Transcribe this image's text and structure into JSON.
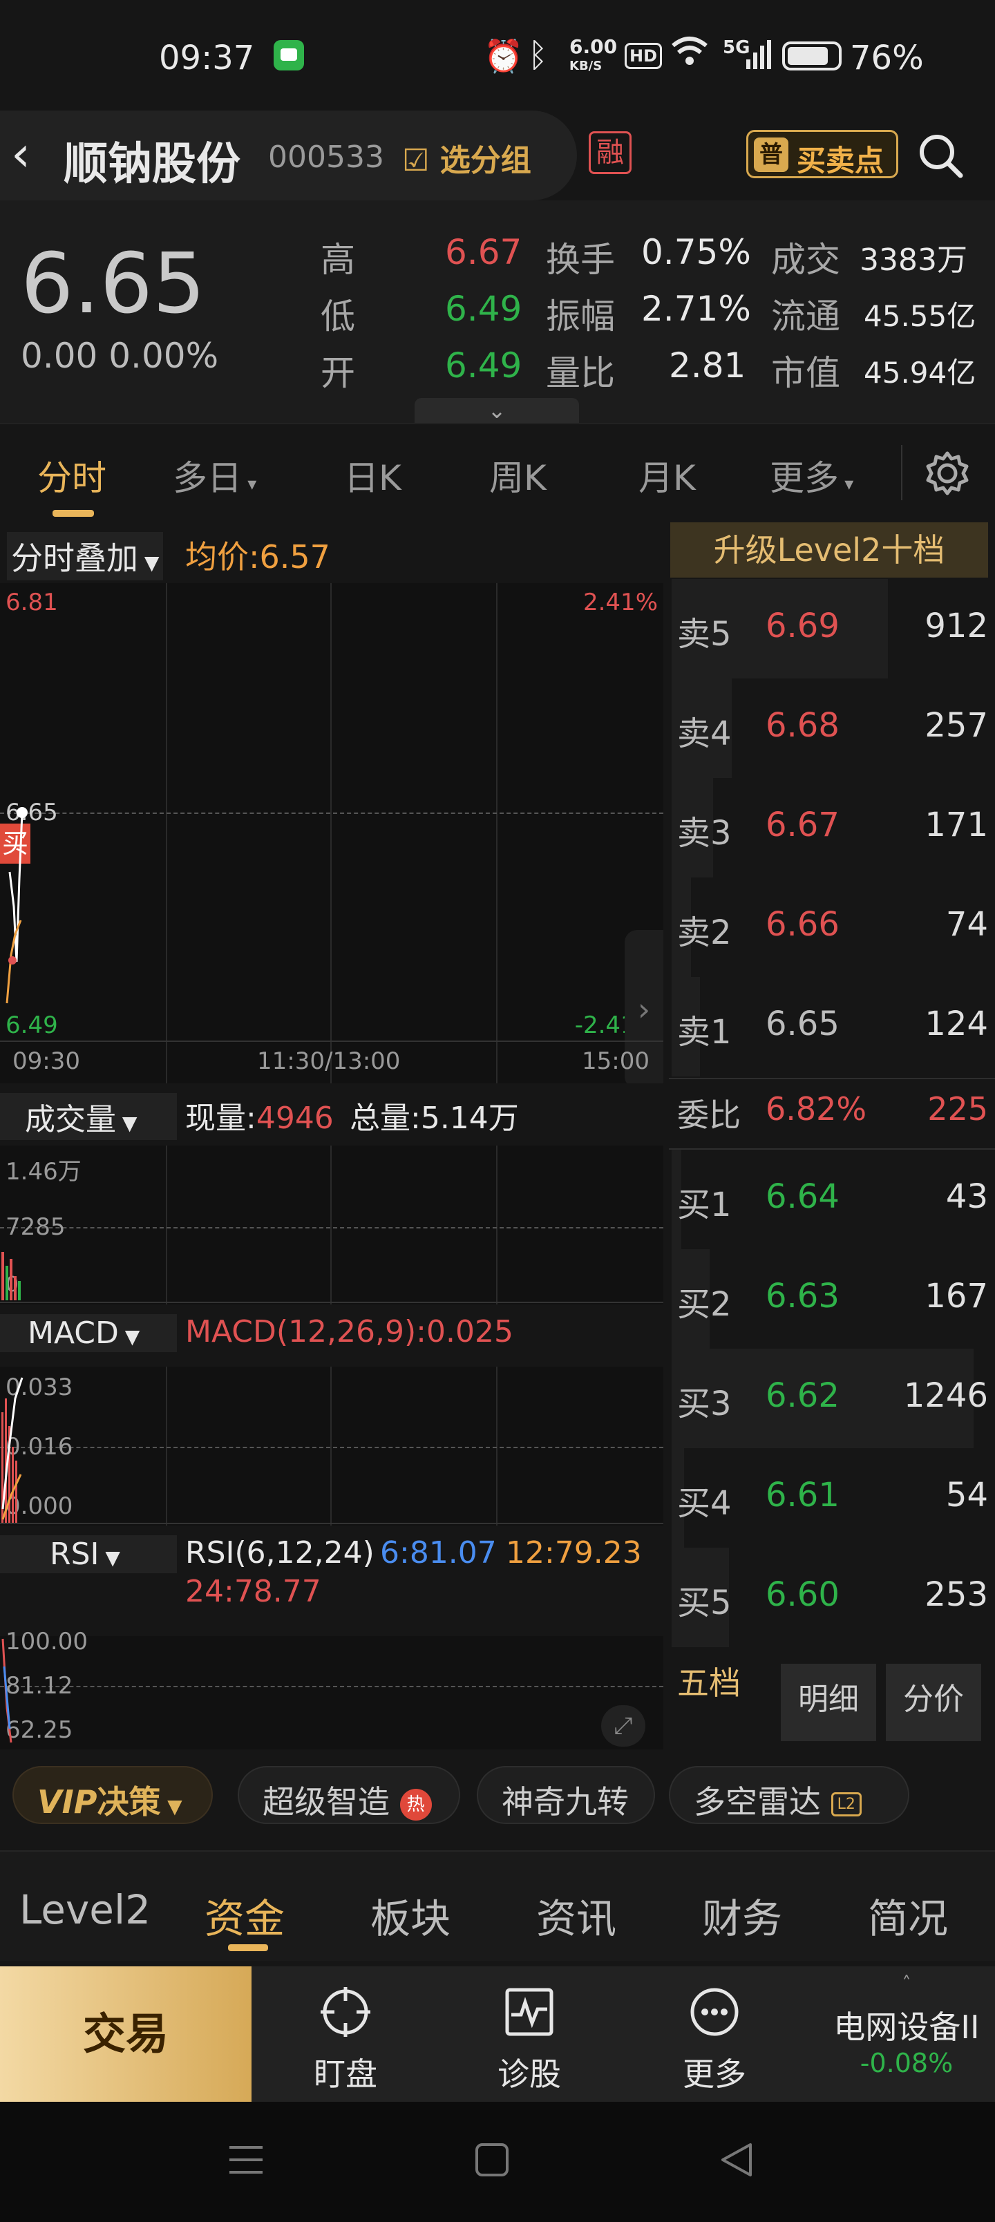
{
  "status_bar": {
    "time": "09:37",
    "net_speed_value": "6.00",
    "net_speed_unit": "KB/S",
    "hd": "HD",
    "signal": "5G",
    "battery": "76%"
  },
  "header": {
    "stock_name": "顺钠股份",
    "stock_code": "000533",
    "group_btn": "选分组",
    "rong_badge": "融",
    "buysell_badge_icon": "普",
    "buysell_label": "买卖点"
  },
  "quote": {
    "price": "6.65",
    "change": "0.00",
    "change_pct": "0.00%",
    "high_label": "高",
    "high": "6.67",
    "low_label": "低",
    "low": "6.49",
    "open_label": "开",
    "open": "6.49",
    "turnover_label": "换手",
    "turnover": "0.75%",
    "amplitude_label": "振幅",
    "amplitude": "2.71%",
    "vol_ratio_label": "量比",
    "vol_ratio": "2.81",
    "deal_label": "成交",
    "deal": "3383万",
    "float_label": "流通",
    "float": "45.55亿",
    "mktcap_label": "市值",
    "mktcap": "45.94亿"
  },
  "tabs": [
    {
      "label": "分时",
      "active": true
    },
    {
      "label": "多日",
      "dropdown": true
    },
    {
      "label": "日K"
    },
    {
      "label": "周K"
    },
    {
      "label": "月K"
    },
    {
      "label": "更多",
      "dropdown": true
    }
  ],
  "chart": {
    "overlay_label": "分时叠加",
    "avg_label": "均价:",
    "avg_price": "6.57",
    "y_max": "6.81",
    "y_max_pct": "2.41%",
    "y_mid": "6.65",
    "y_min": "6.49",
    "y_min_pct": "-2.41%",
    "buy_marker": "买",
    "time_start": "09:30",
    "time_mid": "11:30/13:00",
    "time_end": "15:00",
    "volume": {
      "label": "成交量",
      "now_label": "现量:",
      "now": "4946",
      "total_label": "总量:",
      "total": "5.14万",
      "y_top": "1.46万",
      "y_mid": "7285",
      "y_bottom": "0"
    },
    "macd": {
      "label": "MACD",
      "formula": "MACD(12,26,9):",
      "value": "0.025",
      "y_top": "0.033",
      "y_mid": "0.016",
      "y_bottom": "0.000"
    },
    "rsi": {
      "label": "RSI",
      "formula": "RSI(6,12,24)",
      "rsi6": "6:81.07",
      "rsi12": "12:79.23",
      "rsi24": "24:78.77",
      "y_top": "100.00",
      "y_mid": "81.12",
      "y_bottom": "62.25"
    }
  },
  "orderbook": {
    "upgrade_label": "升级Level2十档",
    "asks": [
      {
        "name": "卖5",
        "price": "6.69",
        "vol": "912",
        "fill": 0.68
      },
      {
        "name": "卖4",
        "price": "6.68",
        "vol": "257",
        "fill": 0.19
      },
      {
        "name": "卖3",
        "price": "6.67",
        "vol": "171",
        "fill": 0.13
      },
      {
        "name": "卖2",
        "price": "6.66",
        "vol": "74",
        "fill": 0.06
      },
      {
        "name": "卖1",
        "price": "6.65",
        "vol": "124",
        "fill": 0.09
      }
    ],
    "commission_label": "委比",
    "commission_pct": "6.82%",
    "commission_vol": "225",
    "bids": [
      {
        "name": "买1",
        "price": "6.64",
        "vol": "43",
        "fill": 0.03
      },
      {
        "name": "买2",
        "price": "6.63",
        "vol": "167",
        "fill": 0.12
      },
      {
        "name": "买3",
        "price": "6.62",
        "vol": "1246",
        "fill": 0.95
      },
      {
        "name": "买4",
        "price": "6.61",
        "vol": "54",
        "fill": 0.04
      },
      {
        "name": "买5",
        "price": "6.60",
        "vol": "253",
        "fill": 0.18
      }
    ],
    "mode_tabs": [
      "五档",
      "明细",
      "分价"
    ]
  },
  "feature_chips": {
    "vip": "VIP",
    "vip_label": "决策",
    "chip1": "超级智造",
    "chip1_badge": "热",
    "chip2": "神奇九转",
    "chip3": "多空雷达",
    "chip3_badge": "L2"
  },
  "footer_tabs": [
    "Level2",
    "资金",
    "板块",
    "资讯",
    "财务",
    "简况"
  ],
  "actions": {
    "trade": "交易",
    "watch": "盯盘",
    "diagnose": "诊股",
    "more": "更多",
    "sector_name": "电网设备II",
    "sector_change": "-0.08%"
  },
  "colors": {
    "up": "#e05252",
    "down": "#2fb34a",
    "accent": "#d9a94f",
    "avg_line": "#f0a040"
  }
}
